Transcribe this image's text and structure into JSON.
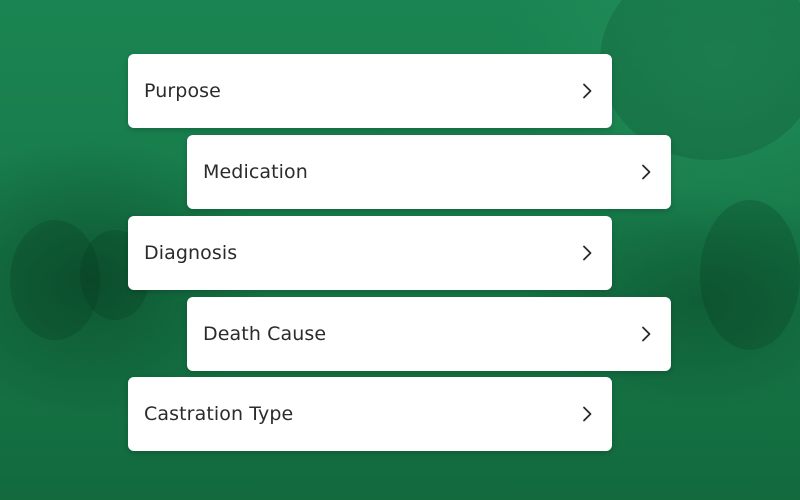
{
  "menu": {
    "items": [
      {
        "label": "Purpose",
        "icon": "chevron-right-icon"
      },
      {
        "label": "Medication",
        "icon": "chevron-right-icon"
      },
      {
        "label": "Diagnosis",
        "icon": "chevron-right-icon"
      },
      {
        "label": "Death Cause",
        "icon": "chevron-right-icon"
      },
      {
        "label": "Castration Type",
        "icon": "chevron-right-icon"
      }
    ]
  },
  "colors": {
    "background_green": "#187a4b",
    "card_background": "#ffffff",
    "text": "#2b2b2b"
  }
}
